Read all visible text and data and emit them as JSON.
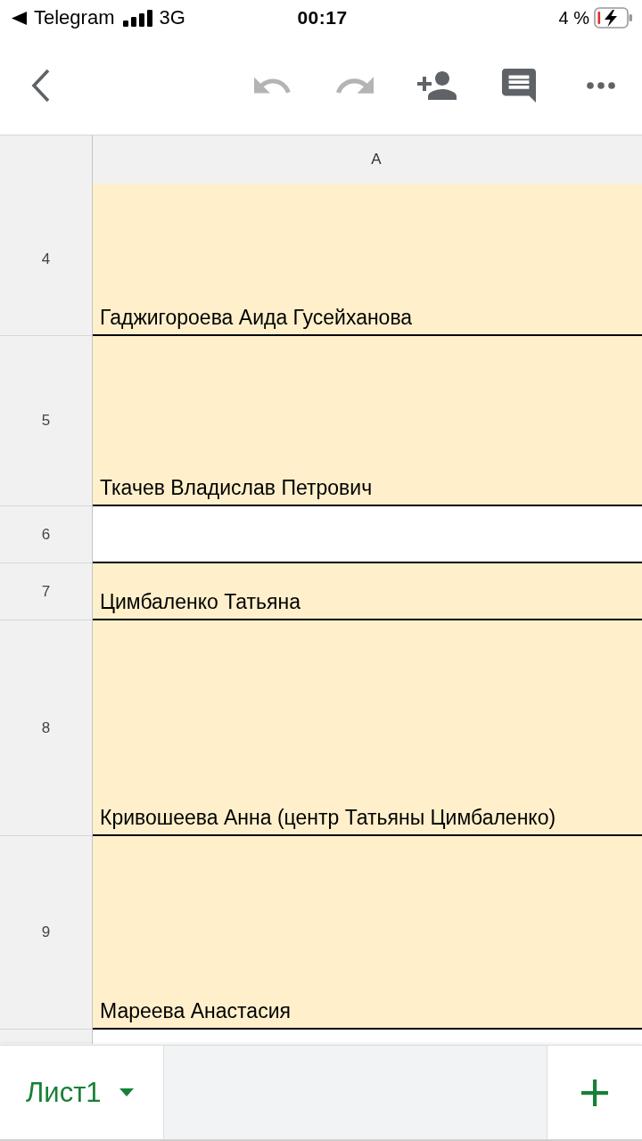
{
  "status_bar": {
    "back_label": "Telegram",
    "network": "3G",
    "time": "00:17",
    "battery": "4 %"
  },
  "toolbar": {
    "undo": {
      "disabled": true
    },
    "redo": {
      "disabled": true
    }
  },
  "sheet": {
    "columns": [
      "A"
    ],
    "rows": [
      {
        "number": "4",
        "cell": "Гаджигороева Аида Гусейханова",
        "color": "#fff0cb"
      },
      {
        "number": "5",
        "cell": "Ткачев Владислав Петрович",
        "color": "#fff0cb"
      },
      {
        "number": "6",
        "color": "#ffffff"
      },
      {
        "number": "7",
        "cell": "Цимбаленко Татьяна",
        "color": "#fff0cb"
      },
      {
        "number": "8",
        "cell": "Кривошеева Анна (центр Татьяны Цимбаленко)",
        "color": "#fff0cb"
      },
      {
        "number": "9",
        "cell": "Мареева Анастасия",
        "color": "#fff0cb"
      }
    ]
  },
  "sheet_tabs": [
    {
      "label": "Лист1",
      "selected": true
    }
  ]
}
